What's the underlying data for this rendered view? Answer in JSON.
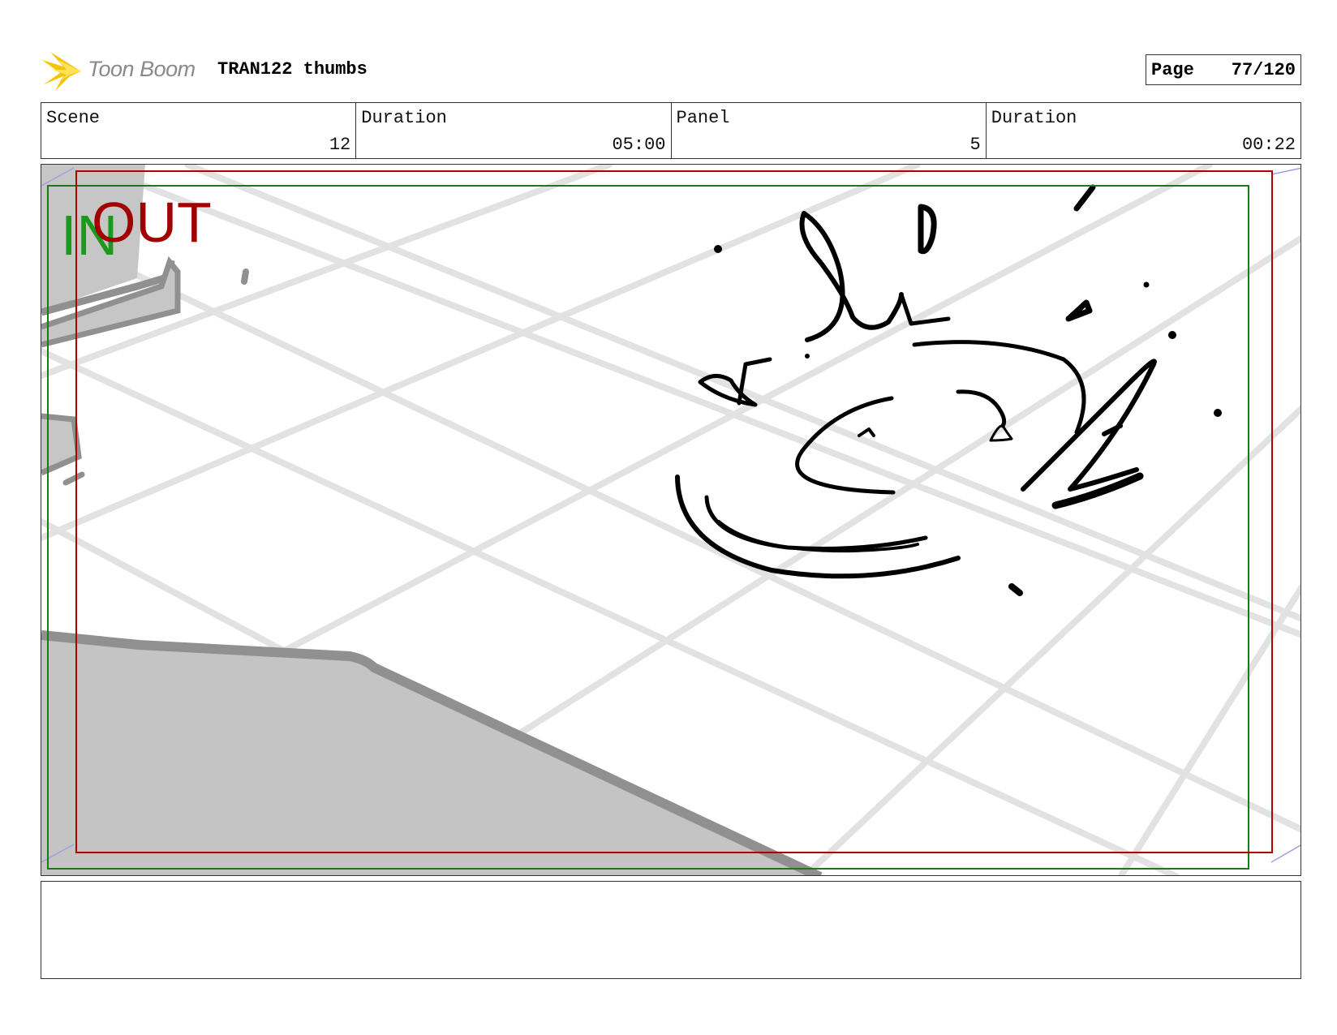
{
  "header": {
    "logo_text": "Toon Boom",
    "title": "TRAN122 thumbs",
    "page_label": "Page",
    "page_value": "77/120"
  },
  "info": {
    "scene_label": "Scene",
    "scene_value": "12",
    "scene_duration_label": "Duration",
    "scene_duration_value": "05:00",
    "panel_label": "Panel",
    "panel_value": "5",
    "panel_duration_label": "Duration",
    "panel_duration_value": "00:22"
  },
  "frame": {
    "in_label": "IN",
    "out_label": "OUT",
    "in_color": "#1a9a1a",
    "out_color": "#a00000"
  },
  "notes": {
    "text": ""
  }
}
